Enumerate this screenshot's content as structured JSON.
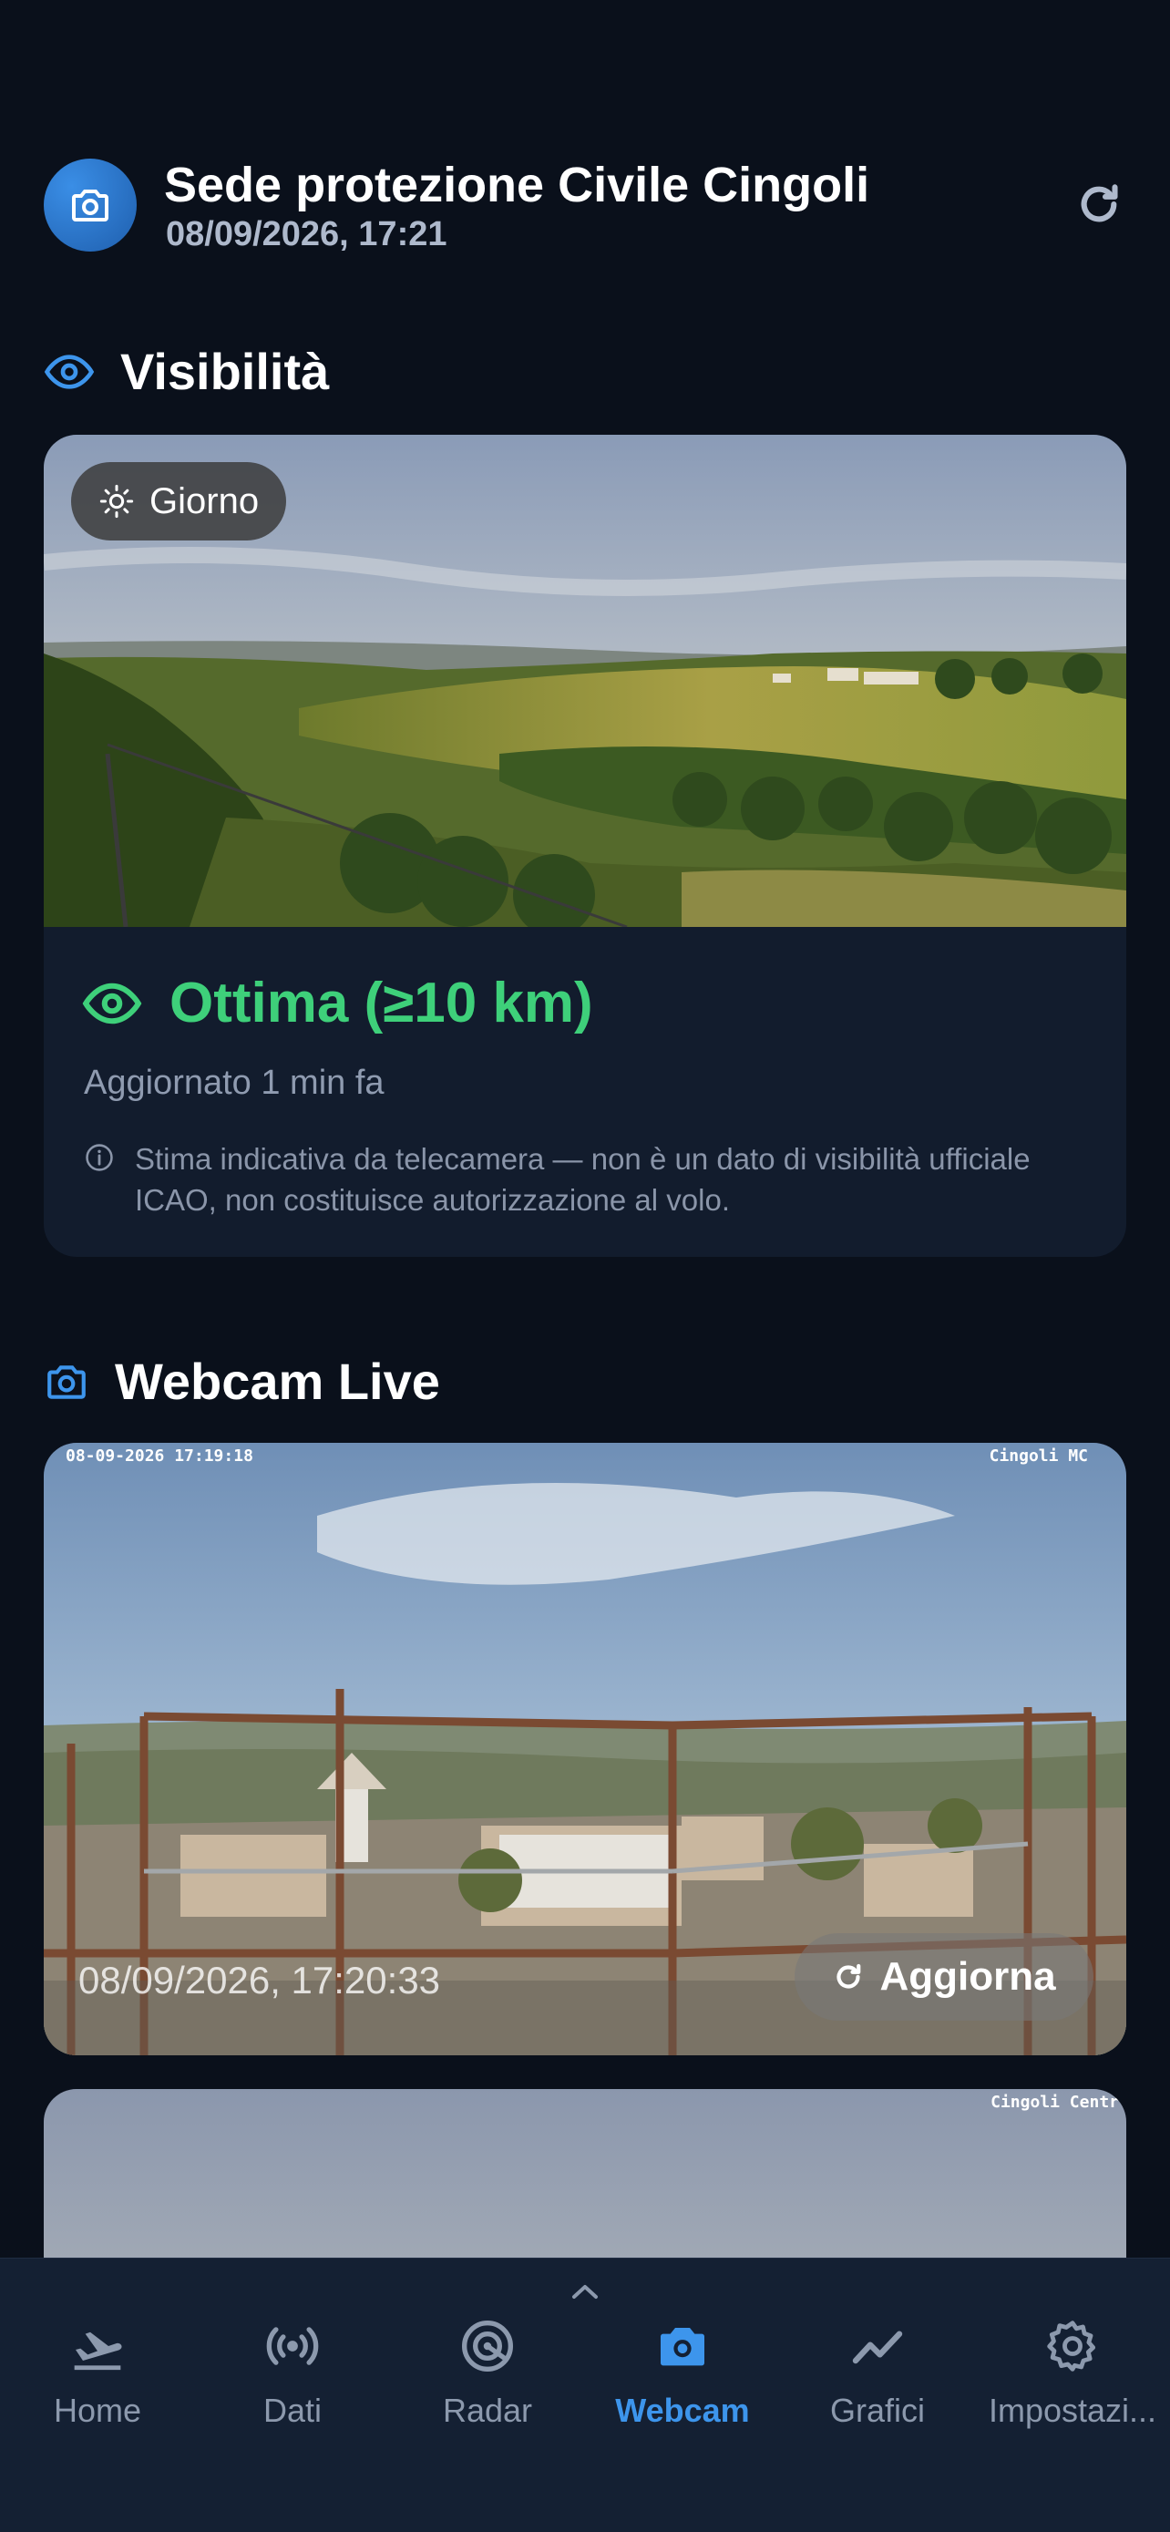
{
  "header": {
    "station_name": "Sede protezione Civile Cingoli",
    "datetime": "08/09/2026, 17:21",
    "avatar_icon": "camera-icon",
    "refresh_icon": "refresh-icon"
  },
  "visibility": {
    "section_title": "Visibilità",
    "section_icon": "eye-icon",
    "badge_label": "Giorno",
    "badge_icon": "sun-icon",
    "status": "Ottima (≥10 km)",
    "status_color": "#3ed07a",
    "updated": "Aggiornato 1 min fa",
    "disclaimer": "Stima indicativa da telecamera — non è un dato di visibilità ufficiale ICAO, non costituisce autorizzazione al volo."
  },
  "webcam": {
    "section_title": "Webcam Live",
    "section_icon": "camera-icon",
    "cams": [
      {
        "overlay_left": "08-09-2026 17:19:18",
        "overlay_right": "Cingoli MC",
        "timestamp": "08/09/2026, 17:20:33",
        "refresh_label": "Aggiorna"
      },
      {
        "overlay_right": "Cingoli Centr"
      }
    ]
  },
  "nav": {
    "items": [
      {
        "label": "Home",
        "icon": "airplane-icon"
      },
      {
        "label": "Dati",
        "icon": "broadcast-icon"
      },
      {
        "label": "Radar",
        "icon": "radar-icon"
      },
      {
        "label": "Webcam",
        "icon": "camera-icon"
      },
      {
        "label": "Grafici",
        "icon": "chart-line-icon"
      },
      {
        "label": "Impostazi...",
        "icon": "gear-icon"
      }
    ],
    "active": "Webcam",
    "active_color": "#3d95ec"
  },
  "colors": {
    "background": "#0a101b",
    "card": "#121c2d",
    "accent": "#3d95ec"
  }
}
